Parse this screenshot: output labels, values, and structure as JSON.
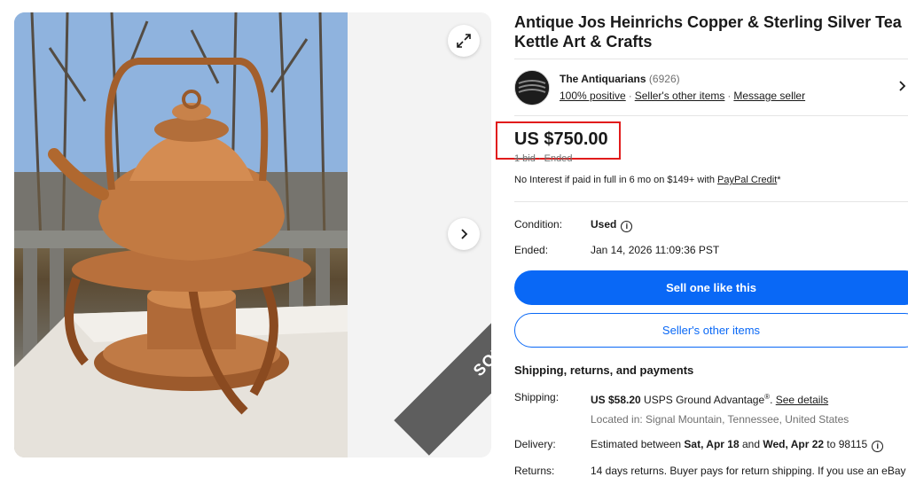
{
  "gallery": {
    "sold_label": "SOLD",
    "expand_icon": "expand-icon",
    "next_icon": "chevron-right-icon"
  },
  "listing": {
    "title": "Antique Jos Heinrichs Copper & Sterling Silver Tea Kettle Art & Crafts"
  },
  "seller": {
    "name": "The Antiquarians",
    "feedback_count": "(6926)",
    "positive": "100% positive",
    "other_items": "Seller's other items",
    "message": "Message seller"
  },
  "price": {
    "amount": "US $750.00",
    "bids": "1 bid",
    "status": "Ended",
    "financing_prefix": "No Interest if paid in full in 6 mo on $149+ with ",
    "financing_link": "PayPal Credit",
    "financing_suffix": "*"
  },
  "details": {
    "condition_label": "Condition:",
    "condition_value": "Used",
    "ended_label": "Ended:",
    "ended_value": "Jan 14, 2026 11:09:36 PST"
  },
  "actions": {
    "sell_like": "Sell one like this",
    "seller_items": "Seller's other items"
  },
  "shipping": {
    "section_title": "Shipping, returns, and payments",
    "shipping_label": "Shipping:",
    "shipping_cost": "US $58.20",
    "shipping_method": " USPS Ground Advantage",
    "shipping_reg": "®",
    "shipping_see": "See details",
    "location": "Located in: Signal Mountain, Tennessee, United States",
    "delivery_label": "Delivery:",
    "delivery_prefix": "Estimated between ",
    "delivery_start": "Sat, Apr 18",
    "delivery_and": " and ",
    "delivery_end": "Wed, Apr 22",
    "delivery_to": " to 98115",
    "returns_label": "Returns:",
    "returns_value": "14 days returns. Buyer pays for return shipping. If you use an eBay"
  },
  "colors": {
    "accent": "#0968f6",
    "highlight_box": "#e11b1b",
    "sold_ribbon": "#5e5e5e"
  }
}
